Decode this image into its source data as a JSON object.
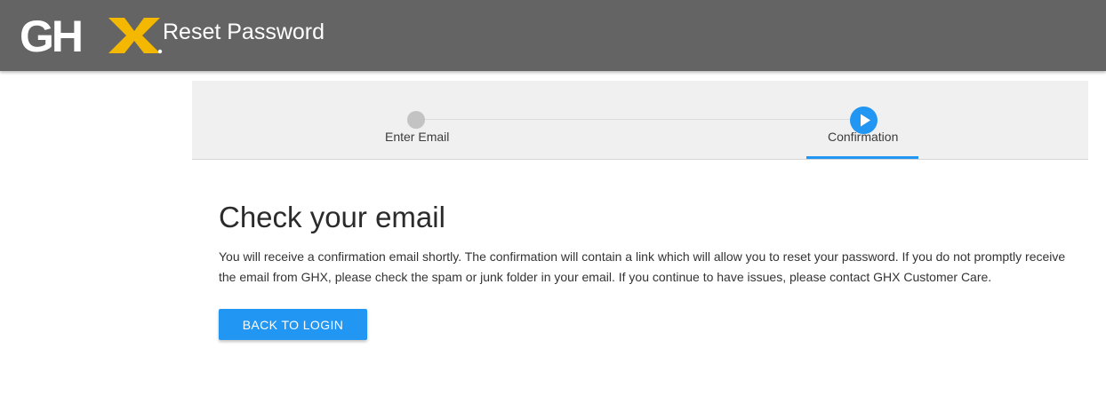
{
  "header": {
    "logo_text": "GHX",
    "title": "Reset Password"
  },
  "stepper": {
    "steps": [
      {
        "label": "Enter Email",
        "state": "completed"
      },
      {
        "label": "Confirmation",
        "state": "current"
      }
    ]
  },
  "main": {
    "heading": "Check your email",
    "description": "You will receive a confirmation email shortly. The confirmation will contain a link which will allow you to reset your password. If you do not promptly receive the email from GHX, please check the spam or junk folder in your email. If you continue to have issues, please contact GHX Customer Care.",
    "button_label": "BACK TO LOGIN"
  },
  "colors": {
    "header_bg": "#646464",
    "accent": "#2196f3",
    "logo_x": "#f5b800",
    "stepper_bg": "#f0f0f0"
  },
  "icons": {
    "current_step": "play-icon"
  }
}
